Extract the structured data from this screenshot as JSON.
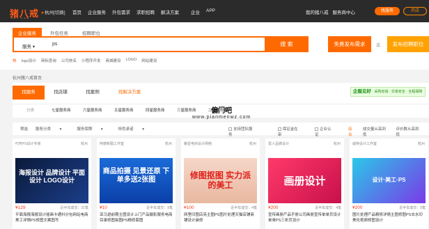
{
  "brand": {
    "logo": "猪八戒",
    "sub": "ZBJ.COM"
  },
  "topbar": {
    "city": "杭州[切换]",
    "nav": [
      "首页",
      "企业服务",
      "外包需求",
      "求职招聘",
      "解决方案",
      "企业",
      "APP"
    ],
    "right": [
      "我的猪八戒",
      "服务商中心"
    ],
    "btn_hire": "找服务",
    "btn_open": "开店"
  },
  "search": {
    "tabs": [
      "企业服务",
      "外包任务",
      "招聘职位"
    ],
    "type": "服务",
    "value": "ps",
    "button": "搜 索",
    "publish": "免费发布需求",
    "or": "或",
    "publish2": "发布招聘职位"
  },
  "hot": {
    "label": "热",
    "items": [
      "logo设计",
      "商标查询",
      "公司核名",
      "小程序开发",
      "商城建设",
      "LOGO",
      "网站建设"
    ]
  },
  "crumb": "杭州猪八戒首页",
  "tabs": [
    "找服务",
    "找店铺",
    "找案例",
    "找解决方案"
  ],
  "promo": {
    "brand": "企服见好",
    "text": "· 采购省钱 · 交易安全 · 全程保障"
  },
  "filter": {
    "label": "分类",
    "items": [
      "七星服务商",
      "六星服务商",
      "五星服务商",
      "四星服务商",
      "三星服务商",
      "二星服务商"
    ]
  },
  "sort": {
    "label": "筛选",
    "items": [
      "服务分类",
      "服务保障",
      "特色承诺"
    ],
    "checks": [
      "支持团队服务",
      "保证金在审",
      "企业认证"
    ],
    "right": [
      "综合",
      "成交量从高到低",
      "评价数从高到低"
    ]
  },
  "watermark": {
    "main": "偏门吧",
    "url": "www.pianmenwz.com"
  },
  "cards": [
    {
      "shop": "叮咚PS设计专家",
      "loc": "杭州",
      "badge": "",
      "price": "¥129",
      "sales": "近半年成交：21笔",
      "title": "平面海报海报设计插画卡通抖分包网站电商美工详情PS修图文案图写",
      "thumb_text": "海报设计 品牌设计 平面设计 LOGO设计"
    },
    {
      "shop": "阿德新图工作室",
      "loc": "杭州",
      "badge": "",
      "price": "¥10",
      "sales": "近半年成交：9笔",
      "title": "亚马逊前期主图设计上门产品摄影服务电商目录修图拍图PS精修套图",
      "thumb_text": "商品拍摄 见景还原 下单多送2张图"
    },
    {
      "shop": "聚星电商设计网络",
      "loc": "杭州",
      "badge": "",
      "price": "¥100",
      "sales": "近半年成交：4笔",
      "title": "网里印图店亮主图PS图片处理天猫店铺商铺设计装修",
      "thumb_text": "修图抠图 实力派的美工"
    },
    {
      "shop": "雷人品牌设计",
      "loc": "杭州",
      "badge": "",
      "price": "¥200",
      "sales": "近半年成交：4笔",
      "title": "宣传画册产品手册公司画册宣传单单页设计单单PS三折页设计",
      "thumb_text": "画册设计"
    },
    {
      "shop": "威特设计工作室",
      "loc": "杭州",
      "badge": "",
      "price": "¥200",
      "sales": "近半年成交：0笔",
      "title": "图片处理产品精修详情主图修图PS去水印美化视频修图设计",
      "thumb_text": "设计·美工·PS"
    }
  ],
  "colors": {
    "accent": "#ff6a00",
    "topbar": "#2b2b2b"
  }
}
